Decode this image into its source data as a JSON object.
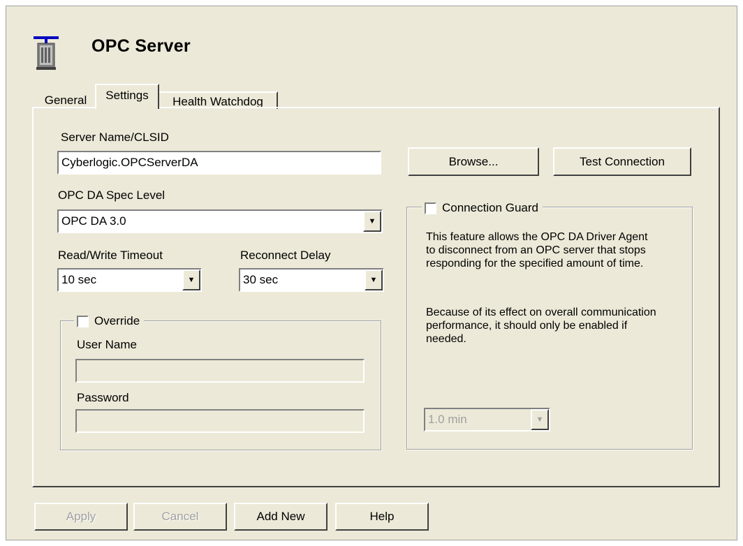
{
  "window": {
    "title": "OPC Server"
  },
  "tabs": [
    {
      "label": "General"
    },
    {
      "label": "Settings"
    },
    {
      "label": "Health Watchdog"
    }
  ],
  "settings": {
    "server_name": {
      "label": "Server Name/CLSID",
      "value": "Cyberlogic.OPCServerDA"
    },
    "browse_label": "Browse...",
    "test_connection_label": "Test Connection",
    "spec_level": {
      "label": "OPC DA Spec Level",
      "value": "OPC DA 3.0"
    },
    "rw_timeout": {
      "label": "Read/Write Timeout",
      "value": "10 sec"
    },
    "reconnect_delay": {
      "label": "Reconnect Delay",
      "value": "30 sec"
    },
    "override": {
      "label": "Override",
      "checked": false,
      "user_name_label": "User Name",
      "user_name_value": "",
      "password_label": "Password",
      "password_value": ""
    },
    "connection_guard": {
      "label": "Connection Guard",
      "checked": false,
      "description_1": "This feature allows the OPC DA Driver Agent to disconnect from an OPC server that stops responding for the specified amount of time.",
      "description_2": "Because of its effect on overall communication performance, it should only be enabled if needed.",
      "timeout_value": "1.0 min"
    }
  },
  "footer": {
    "apply_label": "Apply",
    "cancel_label": "Cancel",
    "add_new_label": "Add New",
    "help_label": "Help"
  }
}
